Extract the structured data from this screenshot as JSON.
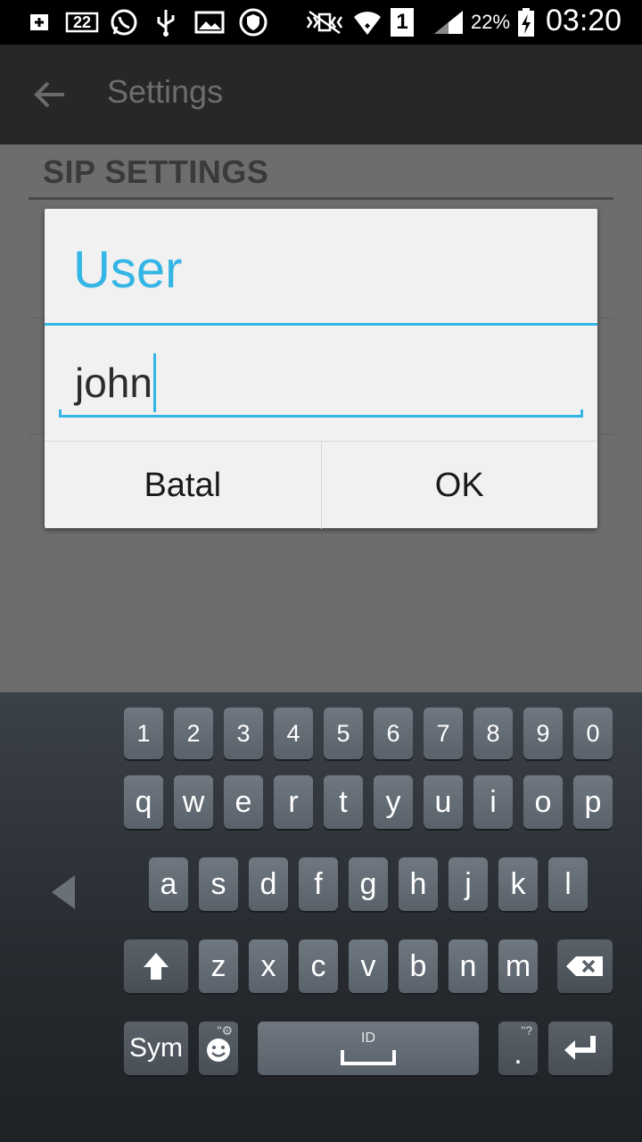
{
  "status_bar": {
    "icons": [
      "plus-box-icon",
      "notification-count-icon",
      "whatsapp-icon",
      "usb-icon",
      "image-icon",
      "shield-icon",
      "vibrate-mute-icon",
      "wifi-icon",
      "sim-1-icon",
      "signal-icon",
      "battery-icon"
    ],
    "notification_count": "22",
    "sim_label": "1",
    "battery": "22%",
    "time": "03:20"
  },
  "action_bar": {
    "title": "Settings",
    "back_icon": "back-arrow-icon"
  },
  "section": {
    "header": "SIP SETTINGS"
  },
  "dialog": {
    "title": "User",
    "input_value": "john",
    "cancel_label": "Batal",
    "ok_label": "OK"
  },
  "keyboard": {
    "row1": [
      "1",
      "2",
      "3",
      "4",
      "5",
      "6",
      "7",
      "8",
      "9",
      "0"
    ],
    "row2": [
      "q",
      "w",
      "e",
      "r",
      "t",
      "y",
      "u",
      "i",
      "o",
      "p"
    ],
    "row3": [
      "a",
      "s",
      "d",
      "f",
      "g",
      "h",
      "j",
      "k",
      "l"
    ],
    "row4": [
      "z",
      "x",
      "c",
      "v",
      "b",
      "n",
      "m"
    ],
    "sym_label": "Sym",
    "space_label": "ID",
    "period_label": ".",
    "period_hint": "\"?",
    "emoji_hint": "\"⚙"
  },
  "colors": {
    "accent": "#33b5e5",
    "action_bar": "#272727",
    "dim_background": "#6d6d6d",
    "dialog": "#f1f1f1"
  }
}
